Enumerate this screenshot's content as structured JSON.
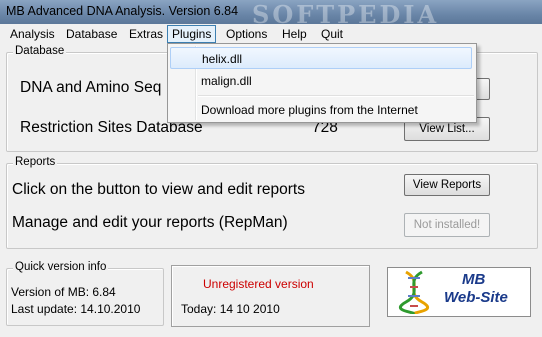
{
  "window": {
    "title": "MB Advanced DNA Analysis. Version 6.84",
    "watermark": "SOFTPEDIA"
  },
  "menu": [
    {
      "label": "Analysis",
      "active": false
    },
    {
      "label": "Database",
      "active": false
    },
    {
      "label": "Extras",
      "active": false
    },
    {
      "label": "Plugins",
      "active": true
    },
    {
      "label": "Options",
      "active": false
    },
    {
      "label": "Help",
      "active": false
    },
    {
      "label": "Quit",
      "active": false
    }
  ],
  "plugins_menu": {
    "items": [
      "helix.dll",
      "malign.dll",
      "Download more plugins from the Internet"
    ]
  },
  "database": {
    "title": "Database",
    "dna_label": "DNA and Amino Seq",
    "restriction_label": "Restriction Sites Database",
    "restriction_count": "728",
    "view_list_button": "View List..."
  },
  "reports": {
    "title": "Reports",
    "view_text": "Click on the button to view and edit reports",
    "view_button": "View Reports",
    "manage_text": "Manage and edit your reports (RepMan)",
    "manage_button": "Not installed!"
  },
  "version_info": {
    "title": "Quick version info",
    "version": "Version of MB: 6.84",
    "last_update": "Last update: 14.10.2010"
  },
  "registration": {
    "status": "Unregistered version",
    "today": "Today: 14 10 2010",
    "status_color": "#cc0000"
  },
  "website": {
    "line1": "MB",
    "line2": "Web-Site",
    "text_color": "#1a3a8a"
  }
}
